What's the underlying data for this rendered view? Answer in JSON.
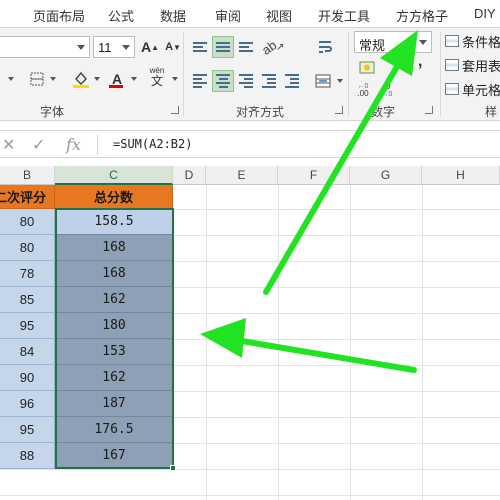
{
  "ribbon_tabs": [
    "页面布局",
    "公式",
    "数据",
    "审阅",
    "视图",
    "开发工具",
    "方方格子",
    "DIY"
  ],
  "font": {
    "size_value": "11",
    "grow_label": "A",
    "shrink_label": "A",
    "color_label": "A",
    "phonetic_label": "wén"
  },
  "groups": {
    "font": "字体",
    "alignment": "对齐方式",
    "number": "数字",
    "styles": "样"
  },
  "number": {
    "format_value": "常规",
    "decimal_increase": ".00",
    "decimal_decrease": ".0"
  },
  "styles": {
    "conditional": "条件格",
    "table": "套用表",
    "cell": "单元格"
  },
  "formula_bar": {
    "formula": "=SUM(A2:B2)",
    "fx_label": "fx"
  },
  "columns": [
    "B",
    "C",
    "D",
    "E",
    "F",
    "G",
    "H"
  ],
  "headers": {
    "b": "二次评分",
    "c": "总分数"
  },
  "rows": [
    {
      "b": "80",
      "c": "158.5"
    },
    {
      "b": "80",
      "c": "168"
    },
    {
      "b": "78",
      "c": "168"
    },
    {
      "b": "85",
      "c": "162"
    },
    {
      "b": "95",
      "c": "180"
    },
    {
      "b": "84",
      "c": "153"
    },
    {
      "b": "90",
      "c": "162"
    },
    {
      "b": "96",
      "c": "187"
    },
    {
      "b": "95",
      "c": "176.5"
    },
    {
      "b": "88",
      "c": "167"
    }
  ],
  "colors": {
    "header_fill": "#e87722",
    "selection_fill": "#8ea0b5",
    "column_b_fill": "#c5d6eb",
    "arrow": "#21e321",
    "selection_border": "#217346"
  },
  "icons": [
    "x-cancel-icon",
    "check-enter-icon",
    "fx-icon",
    "format-painter-icon",
    "fill-color-icon",
    "font-color-icon",
    "align-icon",
    "orientation-icon",
    "wrap-text-icon",
    "merge-cells-icon",
    "percent-icon",
    "comma-icon",
    "decimal-icon",
    "conditional-format-icon",
    "table-style-icon",
    "cell-style-icon",
    "arrow-annotation-icon"
  ]
}
